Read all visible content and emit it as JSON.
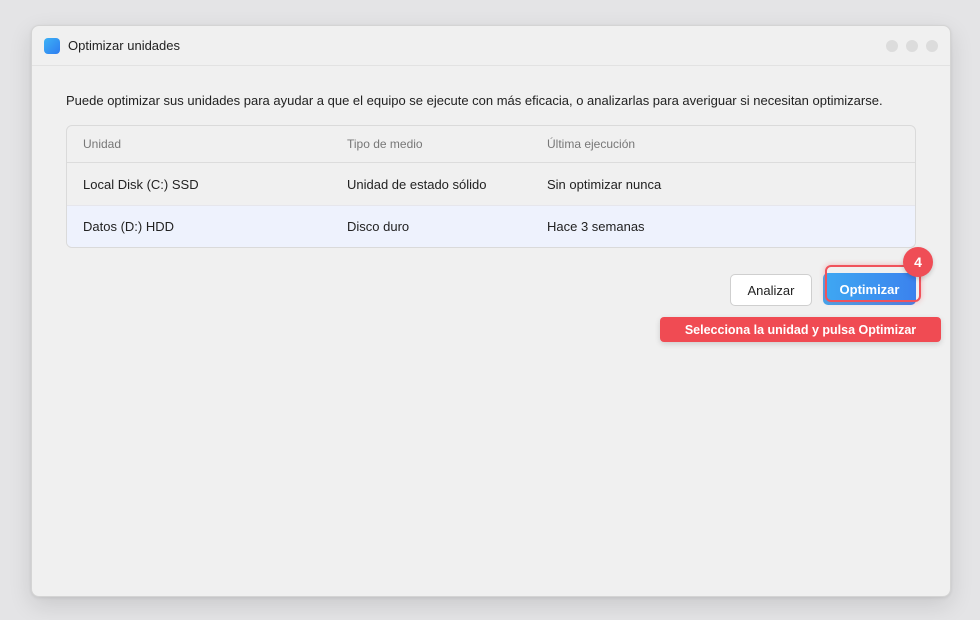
{
  "window": {
    "title": "Optimizar unidades",
    "accent": "#2e7cf0"
  },
  "description": "Puede optimizar sus unidades para ayudar a que el equipo se ejecute con más eficacia, o analizarlas para averiguar si necesitan optimizarse.",
  "table": {
    "columns": [
      "Unidad",
      "Tipo de medio",
      "Última ejecución"
    ],
    "rows": [
      {
        "unidad": "Local Disk (C:) SSD",
        "tipo": "Unidad de estado sólido",
        "ultima": "Sin optimizar nunca",
        "selected": false
      },
      {
        "unidad": "Datos (D:) HDD",
        "tipo": "Disco duro",
        "ultima": "Hace 3 semanas",
        "selected": true
      }
    ]
  },
  "buttons": {
    "analizar": "Analizar",
    "optimizar": "Optimizar"
  },
  "tutorial": {
    "step": "4",
    "tooltip": "Selecciona la unidad y pulsa Optimizar",
    "color": "#ef4d56"
  }
}
